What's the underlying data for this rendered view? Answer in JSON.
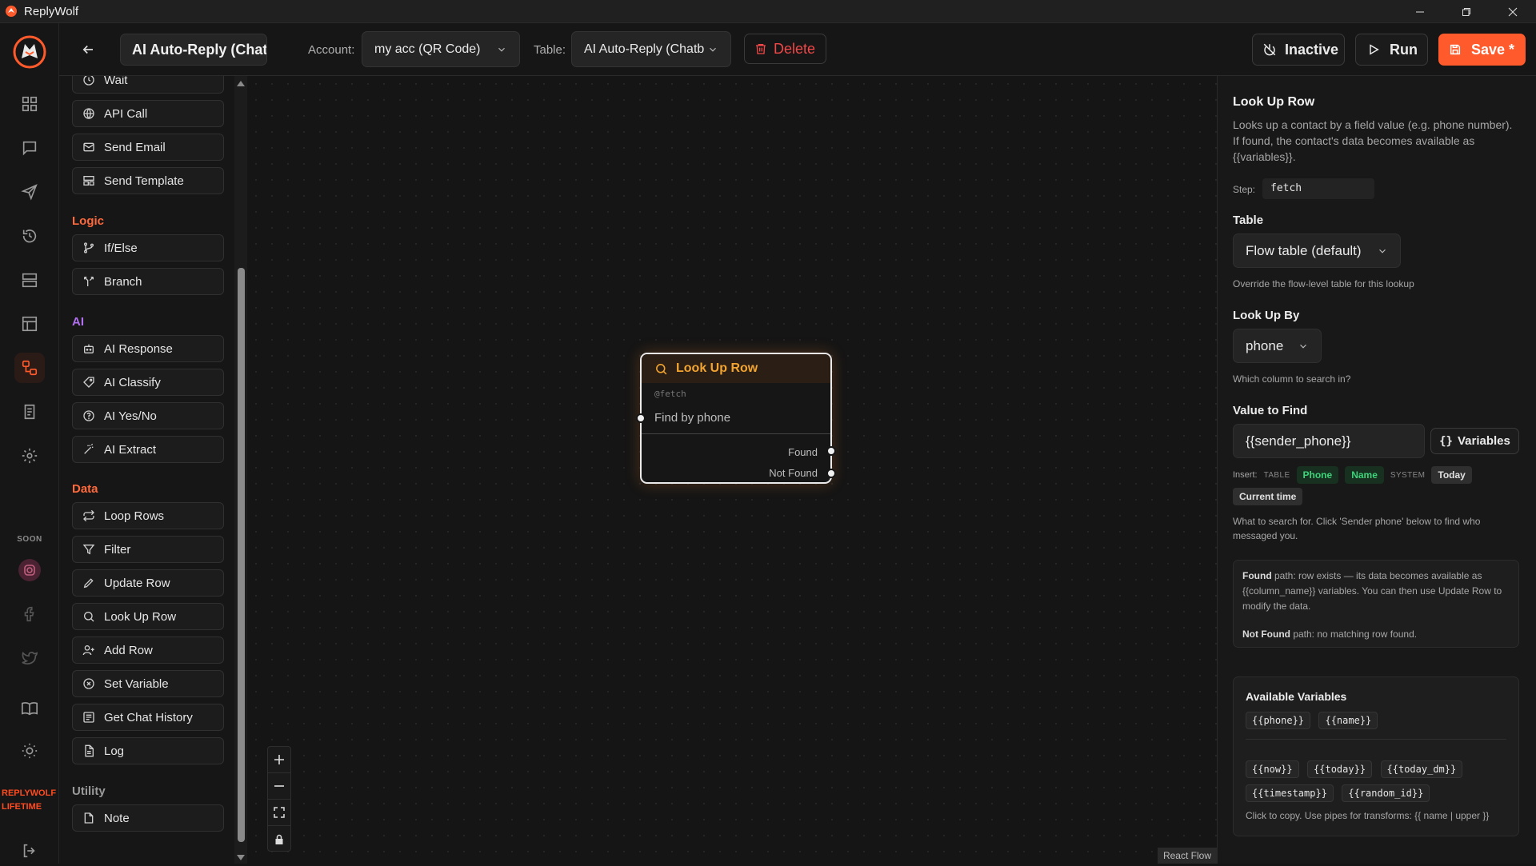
{
  "window": {
    "app_name": "ReplyWolf"
  },
  "rail": {
    "soon_label": "SOON",
    "brand_line1": "REPLYWOLF",
    "brand_line2": "LIFETIME"
  },
  "header": {
    "flow_name": "AI Auto-Reply (Chatbot)",
    "account_label": "Account:",
    "account_value": "my acc (QR Code)",
    "table_label": "Table:",
    "table_value": "AI Auto-Reply (Chatbot)",
    "delete_label": "Delete",
    "inactive_label": "Inactive",
    "run_label": "Run",
    "save_label": "Save *"
  },
  "palette": {
    "top_items": [
      {
        "label": "Wait",
        "icon": "clock-icon"
      },
      {
        "label": "API Call",
        "icon": "globe-icon"
      },
      {
        "label": "Send Email",
        "icon": "mail-icon"
      },
      {
        "label": "Send Template",
        "icon": "template-icon"
      }
    ],
    "sections": [
      {
        "title": "Logic",
        "color": "#ff6a3d",
        "items": [
          {
            "label": "If/Else",
            "icon": "git-branch-icon"
          },
          {
            "label": "Branch",
            "icon": "split-icon"
          }
        ]
      },
      {
        "title": "AI",
        "color": "#b070f0",
        "items": [
          {
            "label": "AI Response",
            "icon": "bot-icon"
          },
          {
            "label": "AI Classify",
            "icon": "tag-icon"
          },
          {
            "label": "AI Yes/No",
            "icon": "help-circle-icon"
          },
          {
            "label": "AI Extract",
            "icon": "wand-icon"
          }
        ]
      },
      {
        "title": "Data",
        "color": "#ff6a3d",
        "items": [
          {
            "label": "Loop Rows",
            "icon": "repeat-icon"
          },
          {
            "label": "Filter",
            "icon": "filter-icon"
          },
          {
            "label": "Update Row",
            "icon": "pencil-icon"
          },
          {
            "label": "Look Up Row",
            "icon": "search-icon"
          },
          {
            "label": "Add Row",
            "icon": "user-plus-icon"
          },
          {
            "label": "Set Variable",
            "icon": "variable-icon"
          },
          {
            "label": "Get Chat History",
            "icon": "history-list-icon"
          },
          {
            "label": "Log",
            "icon": "file-text-icon"
          }
        ]
      },
      {
        "title": "Utility",
        "color": "#9a9a9a",
        "items": [
          {
            "label": "Note",
            "icon": "sticky-note-icon"
          }
        ]
      }
    ]
  },
  "node": {
    "title": "Look Up Row",
    "step": "@fetch",
    "description": "Find by phone",
    "outputs": [
      "Found",
      "Not Found"
    ]
  },
  "canvas": {
    "attribution": "React Flow"
  },
  "panel": {
    "title": "Look Up Row",
    "description": "Looks up a contact by a field value (e.g. phone number). If found, the contact's data becomes available as {{variables}}.",
    "step_label": "Step:",
    "step_value": "fetch",
    "table_label": "Table",
    "table_value": "Flow table (default)",
    "table_hint": "Override the flow-level table for this lookup",
    "lookup_label": "Look Up By",
    "lookup_value": "phone",
    "lookup_hint": "Which column to search in?",
    "value_label": "Value to Find",
    "value_input": "{{sender_phone}}",
    "variables_btn": "Variables",
    "insert_label": "Insert:",
    "insert_table_cat": "TABLE",
    "insert_chip_phone": "Phone",
    "insert_chip_name": "Name",
    "insert_system_cat": "SYSTEM",
    "insert_chip_today": "Today",
    "insert_chip_time": "Current time",
    "value_hint": "What to search for. Click 'Sender phone' below to find who messaged you.",
    "info_found_bold": "Found",
    "info_found_text": " path: row exists — its data becomes available as {{column_name}} variables. You can then use Update Row to modify the data.",
    "info_notfound_bold": "Not Found",
    "info_notfound_text": " path: no matching row found.",
    "avail_title": "Available Variables",
    "avail_table_vars": [
      "{{phone}}",
      "{{name}}"
    ],
    "avail_system_vars_row1": [
      "{{now}}",
      "{{today}}",
      "{{today_dm}}"
    ],
    "avail_system_vars_row2": [
      "{{timestamp}}",
      "{{random_id}}"
    ],
    "avail_hint": "Click to copy. Use pipes for transforms: {{ name | upper }}"
  }
}
